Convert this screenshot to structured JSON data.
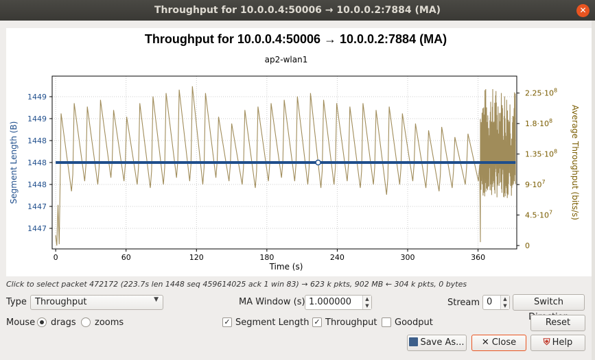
{
  "window": {
    "title": "Throughput for 10.0.0.4:50006 → 10.0.0.2:7884 (MA)",
    "close_icon": "close-icon"
  },
  "chart_data": {
    "type": "line",
    "title": "Throughput for 10.0.0.4:50006 → 10.0.0.2:7884 (MA)",
    "subtitle": "ap2-wlan1",
    "xlabel": "Time (s)",
    "ylabel_left": "Segment Length (B)",
    "ylabel_right": "Average Throughput (bits/s)",
    "x_ticks": [
      "0",
      "60",
      "120",
      "180",
      "240",
      "300",
      "360"
    ],
    "y_left_ticks": [
      "1447",
      "1447",
      "1448",
      "1448",
      "1448",
      "1449",
      "1449"
    ],
    "y_right_ticks": [
      "0",
      "4.5·10",
      "9·10",
      "1.35·10",
      "1.8·10",
      "2.25·10"
    ],
    "y_right_exponents": [
      "",
      "7",
      "7",
      "8",
      "8",
      "8"
    ],
    "xlim": [
      -3,
      393
    ],
    "y_right_lim": [
      -5000000,
      250000000
    ],
    "grid": true,
    "series": [
      {
        "name": "Segment Length",
        "axis": "left",
        "color": "#1f4e8c",
        "values_constant": 1448,
        "x_range": [
          0,
          392
        ]
      },
      {
        "name": "Throughput",
        "axis": "right",
        "color": "#a08c5a",
        "shape": "sawtooth",
        "sawtooth_peaks_bits": [
          195000000,
          210000000,
          205000000,
          215000000,
          200000000,
          190000000,
          210000000,
          220000000,
          225000000,
          230000000,
          235000000,
          225000000,
          190000000,
          180000000,
          200000000,
          205000000,
          210000000,
          215000000,
          220000000,
          225000000,
          215000000,
          210000000,
          205000000,
          210000000,
          200000000,
          205000000,
          195000000,
          180000000,
          170000000,
          175000000,
          160000000,
          165000000
        ],
        "sawtooth_troughs_bits": [
          80000000,
          95000000,
          90000000,
          100000000,
          95000000,
          90000000,
          85000000,
          90000000,
          100000000,
          95000000,
          90000000,
          100000000,
          95000000,
          90000000,
          85000000,
          95000000,
          100000000,
          95000000,
          90000000,
          85000000,
          90000000,
          95000000,
          85000000,
          90000000,
          75000000,
          90000000,
          95000000,
          85000000,
          80000000,
          85000000,
          90000000,
          95000000
        ]
      }
    ]
  },
  "status_text": "Click to select packet 472172 (223.7s len 1448 seq 459614025 ack 1 win 83) → 623 k pkts, 902 MB ← 304 k pkts, 0 bytes",
  "controls": {
    "type_label": "Type",
    "type_value": "Throughput",
    "ma_label": "MA Window (s)",
    "ma_value": "1.000000",
    "stream_label": "Stream",
    "stream_value": "0",
    "switch_direction": "Switch Direction",
    "mouse_label": "Mouse",
    "drags_label": "drags",
    "zooms_label": "zooms",
    "segment_length": "Segment Length",
    "throughput": "Throughput",
    "goodput": "Goodput",
    "reset": "Reset",
    "save_as": "Save As...",
    "close": "Close",
    "help": "Help"
  }
}
